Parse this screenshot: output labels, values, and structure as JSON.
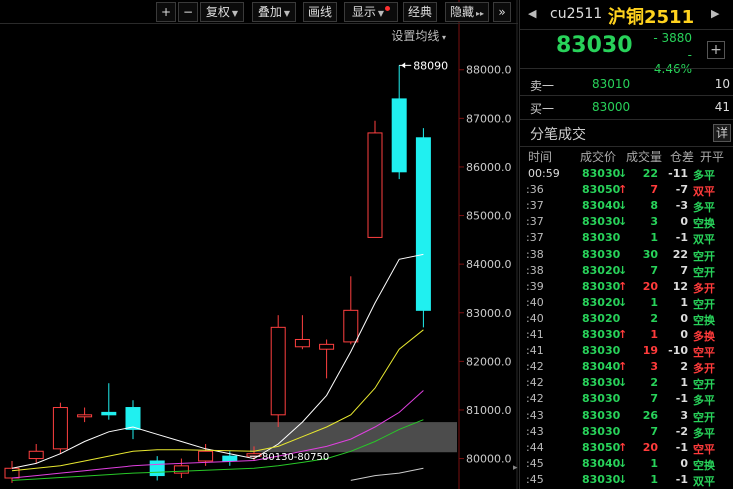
{
  "toolbar": {
    "plus_label": "+",
    "minus_label": "−",
    "adjust_label": "复权",
    "overlay_label": "叠加",
    "draw_label": "画线",
    "display_label": "显示",
    "classic_label": "经典",
    "hide_label": "隐藏",
    "more_label": "»"
  },
  "settings_label": "设置均线",
  "chart_data": {
    "type": "candlestick",
    "y_axis_ticks": [
      "88000.0",
      "87000.0",
      "86000.0",
      "85000.0",
      "84000.0",
      "83000.0",
      "82000.0",
      "81000.0",
      "80000.0"
    ],
    "ylim": [
      79600,
      88900
    ],
    "max_label": "88090",
    "range_label": "80130-80750",
    "candles": [
      {
        "open": 79800,
        "close": 79600,
        "high": 79950,
        "low": 79500,
        "color": "red"
      },
      {
        "open": 80000,
        "close": 80150,
        "high": 80300,
        "low": 79900,
        "color": "red"
      },
      {
        "open": 80200,
        "close": 81050,
        "high": 81150,
        "low": 80100,
        "color": "red"
      },
      {
        "open": 80900,
        "close": 80900,
        "high": 81050,
        "low": 80750,
        "color": "red"
      },
      {
        "open": 80950,
        "close": 80900,
        "high": 81550,
        "low": 80800,
        "color": "cyan"
      },
      {
        "open": 81050,
        "close": 80600,
        "high": 81200,
        "low": 80400,
        "color": "cyan"
      },
      {
        "open": 79950,
        "close": 79650,
        "high": 80050,
        "low": 79550,
        "color": "cyan"
      },
      {
        "open": 79700,
        "close": 79850,
        "high": 80000,
        "low": 79600,
        "color": "red"
      },
      {
        "open": 79950,
        "close": 80150,
        "high": 80300,
        "low": 79850,
        "color": "red"
      },
      {
        "open": 80050,
        "close": 79950,
        "high": 80150,
        "low": 79850,
        "color": "cyan"
      },
      {
        "open": 80100,
        "close": 80050,
        "high": 80250,
        "low": 79950,
        "color": "red"
      },
      {
        "open": 80900,
        "close": 82700,
        "high": 82950,
        "low": 80650,
        "color": "red"
      },
      {
        "open": 82300,
        "close": 82450,
        "high": 82950,
        "low": 82250,
        "color": "red"
      },
      {
        "open": 82250,
        "close": 82350,
        "high": 82450,
        "low": 81650,
        "color": "red"
      },
      {
        "open": 82400,
        "close": 83050,
        "high": 83750,
        "low": 82350,
        "color": "red"
      },
      {
        "open": 84550,
        "close": 86700,
        "high": 86950,
        "low": 84550,
        "color": "red"
      },
      {
        "open": 87400,
        "close": 85900,
        "high": 88090,
        "low": 85750,
        "color": "cyan"
      },
      {
        "open": 86600,
        "close": 83050,
        "high": 86800,
        "low": 82700,
        "color": "cyan"
      }
    ],
    "ma_lines": [
      {
        "name": "ma-white",
        "color": "#ffffff",
        "values": [
          79800,
          79900,
          80100,
          80350,
          80550,
          80650,
          80500,
          80350,
          80200,
          80100,
          80000,
          80300,
          80750,
          81300,
          82200,
          83200,
          84100,
          84200
        ]
      },
      {
        "name": "ma-yellow",
        "color": "#e8e830",
        "values": [
          79750,
          79800,
          79850,
          79950,
          80050,
          80150,
          80180,
          80180,
          80170,
          80160,
          80150,
          80250,
          80450,
          80650,
          80900,
          81450,
          82250,
          82650
        ]
      },
      {
        "name": "ma-magenta",
        "color": "#e040e0",
        "values": [
          79600,
          79650,
          79700,
          79750,
          79800,
          79850,
          79880,
          79900,
          79920,
          79940,
          79960,
          80050,
          80150,
          80250,
          80400,
          80650,
          80950,
          81400
        ]
      },
      {
        "name": "ma-green",
        "color": "#28c828",
        "values": [
          79550,
          79580,
          79610,
          79640,
          79670,
          79700,
          79720,
          79740,
          79760,
          79780,
          79800,
          79850,
          79920,
          80000,
          80150,
          80350,
          80600,
          80800
        ]
      },
      {
        "name": "ma-lightgray",
        "color": "#cccccc",
        "values": [
          null,
          null,
          null,
          null,
          null,
          null,
          null,
          null,
          null,
          null,
          null,
          null,
          null,
          null,
          79550,
          79650,
          79700,
          79800
        ]
      }
    ],
    "colors": {
      "up": "#ff4040",
      "down": "#20f0f0",
      "axis": "#cccccc",
      "grid": "#8a1515"
    }
  },
  "quote": {
    "code": "cu2511",
    "name": "沪铜2511",
    "last_price": "83030",
    "change": "- 3880",
    "change_pct": "- 4.46%",
    "add_label": "+",
    "sell_label": "卖一",
    "sell_price": "83010",
    "sell_vol": "10",
    "buy_label": "买一",
    "buy_price": "83000",
    "buy_vol": "41"
  },
  "ticks": {
    "title": "分笔成交",
    "detail_label": "详",
    "headers": [
      "时间",
      "成交价",
      "成交量",
      "仓差",
      "开平"
    ],
    "rows": [
      {
        "time": "00:59",
        "price": "83030",
        "arrow": "↓",
        "arrow_color": "green",
        "vol": "22",
        "vol_color": "green",
        "oi": "-11",
        "type": "多平",
        "type_color": "green"
      },
      {
        "time": ":36",
        "price": "83050",
        "arrow": "↑",
        "arrow_color": "red",
        "vol": "7",
        "vol_color": "red",
        "oi": "-7",
        "type": "双平",
        "type_color": "red"
      },
      {
        "time": ":37",
        "price": "83040",
        "arrow": "↓",
        "arrow_color": "green",
        "vol": "8",
        "vol_color": "green",
        "oi": "-3",
        "type": "多平",
        "type_color": "green"
      },
      {
        "time": ":37",
        "price": "83030",
        "arrow": "↓",
        "arrow_color": "green",
        "vol": "3",
        "vol_color": "green",
        "oi": "0",
        "type": "空换",
        "type_color": "green"
      },
      {
        "time": ":37",
        "price": "83030",
        "arrow": "",
        "arrow_color": "green",
        "vol": "1",
        "vol_color": "green",
        "oi": "-1",
        "type": "双平",
        "type_color": "green"
      },
      {
        "time": ":38",
        "price": "83030",
        "arrow": "",
        "arrow_color": "green",
        "vol": "30",
        "vol_color": "green",
        "oi": "22",
        "type": "空开",
        "type_color": "green"
      },
      {
        "time": ":38",
        "price": "83020",
        "arrow": "↓",
        "arrow_color": "green",
        "vol": "7",
        "vol_color": "green",
        "oi": "7",
        "type": "空开",
        "type_color": "green"
      },
      {
        "time": ":39",
        "price": "83030",
        "arrow": "↑",
        "arrow_color": "red",
        "vol": "20",
        "vol_color": "red",
        "oi": "12",
        "type": "多开",
        "type_color": "red"
      },
      {
        "time": ":40",
        "price": "83020",
        "arrow": "↓",
        "arrow_color": "green",
        "vol": "1",
        "vol_color": "green",
        "oi": "1",
        "type": "空开",
        "type_color": "green"
      },
      {
        "time": ":40",
        "price": "83020",
        "arrow": "",
        "arrow_color": "green",
        "vol": "2",
        "vol_color": "green",
        "oi": "0",
        "type": "空换",
        "type_color": "green"
      },
      {
        "time": ":41",
        "price": "83030",
        "arrow": "↑",
        "arrow_color": "red",
        "vol": "1",
        "vol_color": "red",
        "oi": "0",
        "type": "多换",
        "type_color": "red"
      },
      {
        "time": ":41",
        "price": "83030",
        "arrow": "",
        "arrow_color": "red",
        "vol": "19",
        "vol_color": "red",
        "oi": "-10",
        "type": "空平",
        "type_color": "red"
      },
      {
        "time": ":42",
        "price": "83040",
        "arrow": "↑",
        "arrow_color": "red",
        "vol": "3",
        "vol_color": "red",
        "oi": "2",
        "type": "多开",
        "type_color": "red"
      },
      {
        "time": ":42",
        "price": "83030",
        "arrow": "↓",
        "arrow_color": "green",
        "vol": "2",
        "vol_color": "green",
        "oi": "1",
        "type": "空开",
        "type_color": "green"
      },
      {
        "time": ":42",
        "price": "83030",
        "arrow": "",
        "arrow_color": "green",
        "vol": "7",
        "vol_color": "green",
        "oi": "-1",
        "type": "多平",
        "type_color": "green"
      },
      {
        "time": ":43",
        "price": "83030",
        "arrow": "",
        "arrow_color": "green",
        "vol": "26",
        "vol_color": "green",
        "oi": "3",
        "type": "空开",
        "type_color": "green"
      },
      {
        "time": ":43",
        "price": "83030",
        "arrow": "",
        "arrow_color": "green",
        "vol": "7",
        "vol_color": "green",
        "oi": "-2",
        "type": "多平",
        "type_color": "green"
      },
      {
        "time": ":44",
        "price": "83050",
        "arrow": "↑",
        "arrow_color": "red",
        "vol": "20",
        "vol_color": "red",
        "oi": "-1",
        "type": "空平",
        "type_color": "red"
      },
      {
        "time": ":45",
        "price": "83040",
        "arrow": "↓",
        "arrow_color": "green",
        "vol": "1",
        "vol_color": "green",
        "oi": "0",
        "type": "空换",
        "type_color": "green"
      },
      {
        "time": ":45",
        "price": "83030",
        "arrow": "↓",
        "arrow_color": "green",
        "vol": "1",
        "vol_color": "green",
        "oi": "-1",
        "type": "双平",
        "type_color": "green"
      }
    ]
  }
}
